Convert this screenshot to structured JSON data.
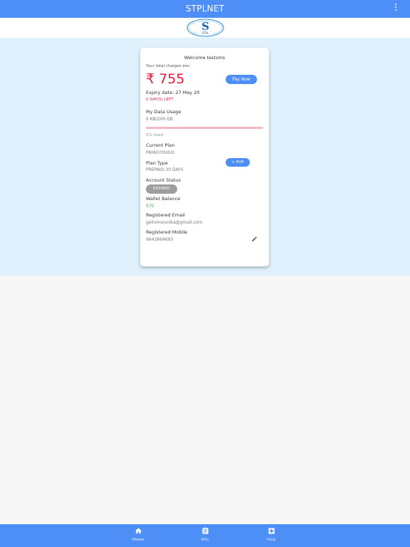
{
  "header": {
    "title": "STPLNET"
  },
  "logo": {
    "letter": "S",
    "text": "STPL"
  },
  "card": {
    "welcome": "Welcome testsms",
    "total_charges_label": "Your total charges are:",
    "amount": "₹ 755",
    "pay_now": "Pay Now",
    "expiry": "Expiry date: 27 May 20",
    "days_left": "0 DAY(S) LEFT",
    "data_usage_label": "My Data Usage",
    "data_usage_value": "0 KB/200 GB",
    "usage_percent": 0,
    "usage_text": "0% Used",
    "current_plan_label": "Current Plan",
    "current_plan_value": "PAYASYOUGO",
    "plan_type_label": "Plan Type",
    "plan_type_value": "PREPAID-30 DAYS",
    "pup_button": "+ PUP",
    "account_status_label": "Account Status",
    "account_status_value": "EXPIRED",
    "wallet_label": "Wallet Balance",
    "wallet_value": "575",
    "email_label": "Registered Email",
    "email_value": "gelivimounika@gmail.com",
    "mobile_label": "Registered Mobile",
    "mobile_value": "9642864693"
  },
  "bottom_nav": [
    {
      "label": "Home",
      "icon": "home-icon"
    },
    {
      "label": "Bills",
      "icon": "clipboard-icon"
    },
    {
      "label": "Help",
      "icon": "medical-plus-icon"
    }
  ],
  "colors": {
    "primary": "#4d8ef7",
    "accent_red": "#e8193c",
    "hero_bg": "#e0f0fc",
    "wallet_green": "#2db553"
  }
}
